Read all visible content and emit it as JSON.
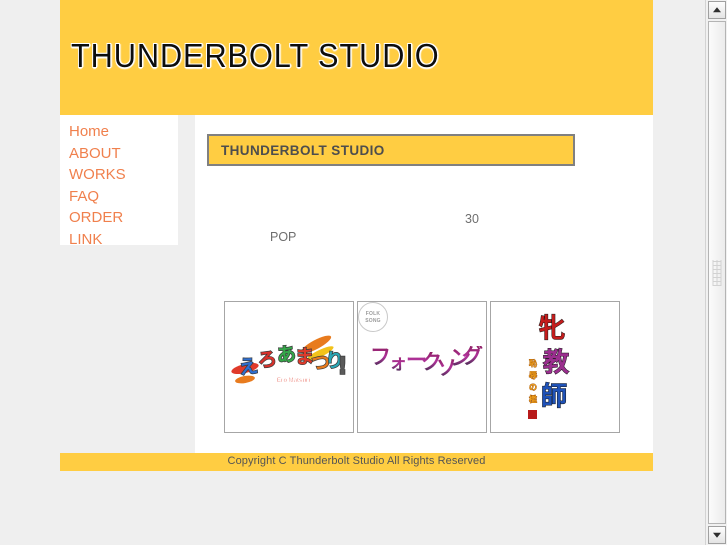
{
  "header": {
    "site_title": "THUNDERBOLT STUDIO",
    "background_color": "#ffcd42"
  },
  "sidebar": {
    "items": [
      {
        "label": "Home"
      },
      {
        "label": "ABOUT"
      },
      {
        "label": "WORKS"
      },
      {
        "label": "FAQ"
      },
      {
        "label": "ORDER"
      },
      {
        "label": "LINK"
      }
    ],
    "link_color": "#f0804d"
  },
  "main": {
    "heading": "THUNDERBOLT STUDIO",
    "heading_box_color": "#ffcd42",
    "heading_border_color": "#808080",
    "description_line_1": "30",
    "description_line_2": "POP",
    "thumbnails": [
      {
        "alt": "colorful-kana-logo",
        "characters": [
          "え",
          "ろ",
          "あ",
          "ま",
          "つ",
          "り",
          "!"
        ],
        "sub_text": "Ero Matsuri",
        "colors": [
          "#2f6fd0",
          "#e03a2a",
          "#35a84a",
          "#e87b1e",
          "#2aa7b5",
          "#d8322c"
        ]
      },
      {
        "alt": "folk-song-katakana-logo",
        "characters": [
          "フ",
          "ォ",
          "ー",
          "ク",
          "ソ",
          "ン",
          "グ"
        ],
        "badge_text": "FOLK SONG",
        "colors": [
          "#8e1f63",
          "#b0329a",
          "#3a2d4a"
        ]
      },
      {
        "alt": "vertical-kanji-logo",
        "characters": [
          "牝",
          "教",
          "師"
        ],
        "side_characters": [
          "恥",
          "辱",
          "の",
          "檻"
        ],
        "colors": [
          "#c41d1d",
          "#9b2f8f",
          "#1f52b8"
        ]
      }
    ]
  },
  "footer": {
    "copyright": "Copyright C  Thunderbolt Studio All Rights Reserved",
    "background_color": "#ffcd42"
  },
  "scrollbar": {
    "up_arrow": "scroll-up-arrow",
    "down_arrow": "scroll-down-arrow"
  },
  "page": {
    "background_color": "#efefef",
    "content_background": "#ffffff"
  }
}
